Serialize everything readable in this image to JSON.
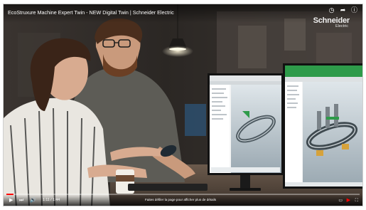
{
  "video": {
    "title": "EcoStruxure Machine Expert Twin - NEW Digital Twin | Schneider Electric",
    "progress": 0.02,
    "time": "1:11 / 1:44",
    "hint": "Faites défiler la page pour afficher plus de détails"
  },
  "brand": {
    "name": "Schneider",
    "sub": "Electric"
  },
  "icons": {
    "clock": "clock-icon",
    "share": "share-icon",
    "info": "info-icon",
    "play": "play-icon",
    "next": "next-icon",
    "volume": "volume-icon",
    "subtitles": "subtitles-icon",
    "youtube": "youtube-icon",
    "fullscreen": "fullscreen-icon"
  },
  "colors": {
    "progress": "#ff0000",
    "screen_green": "#2e9b4a"
  }
}
